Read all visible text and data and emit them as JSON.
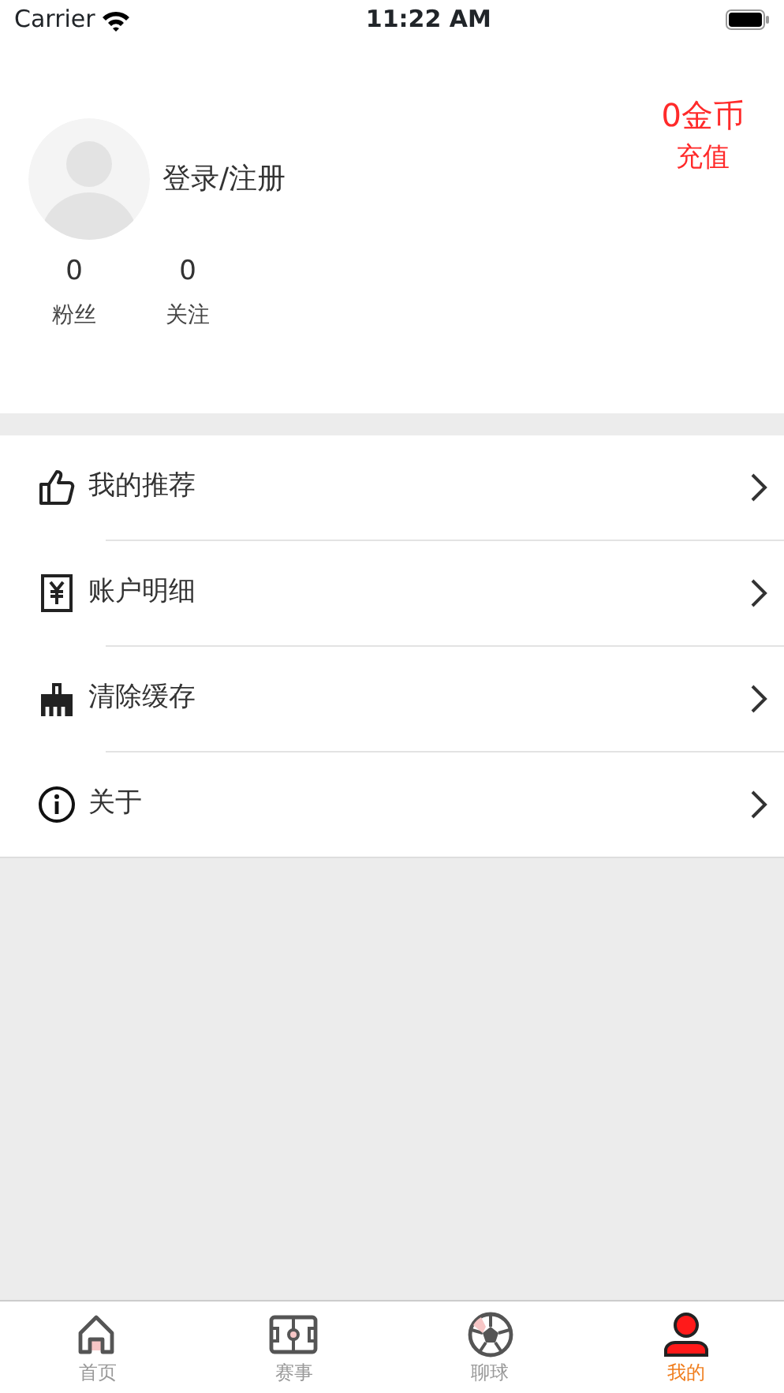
{
  "status_bar": {
    "carrier": "Carrier",
    "time": "11:22 AM"
  },
  "profile": {
    "login": "登录/注册",
    "coins": "0金币",
    "recharge": "充值",
    "stats": [
      {
        "value": "0",
        "label": "粉丝"
      },
      {
        "value": "0",
        "label": "关注"
      }
    ]
  },
  "menu": [
    {
      "kind": "thumb",
      "label": "我的推荐"
    },
    {
      "kind": "yen",
      "label": "账户明细"
    },
    {
      "kind": "broom",
      "label": "清除缓存"
    },
    {
      "kind": "info",
      "label": "关于"
    }
  ],
  "tabs": [
    {
      "kind": "home",
      "label": "首页",
      "selected": false
    },
    {
      "kind": "field",
      "label": "赛事",
      "selected": false
    },
    {
      "kind": "ball",
      "label": "聊球",
      "selected": false
    },
    {
      "kind": "user",
      "label": "我的",
      "selected": true
    }
  ]
}
